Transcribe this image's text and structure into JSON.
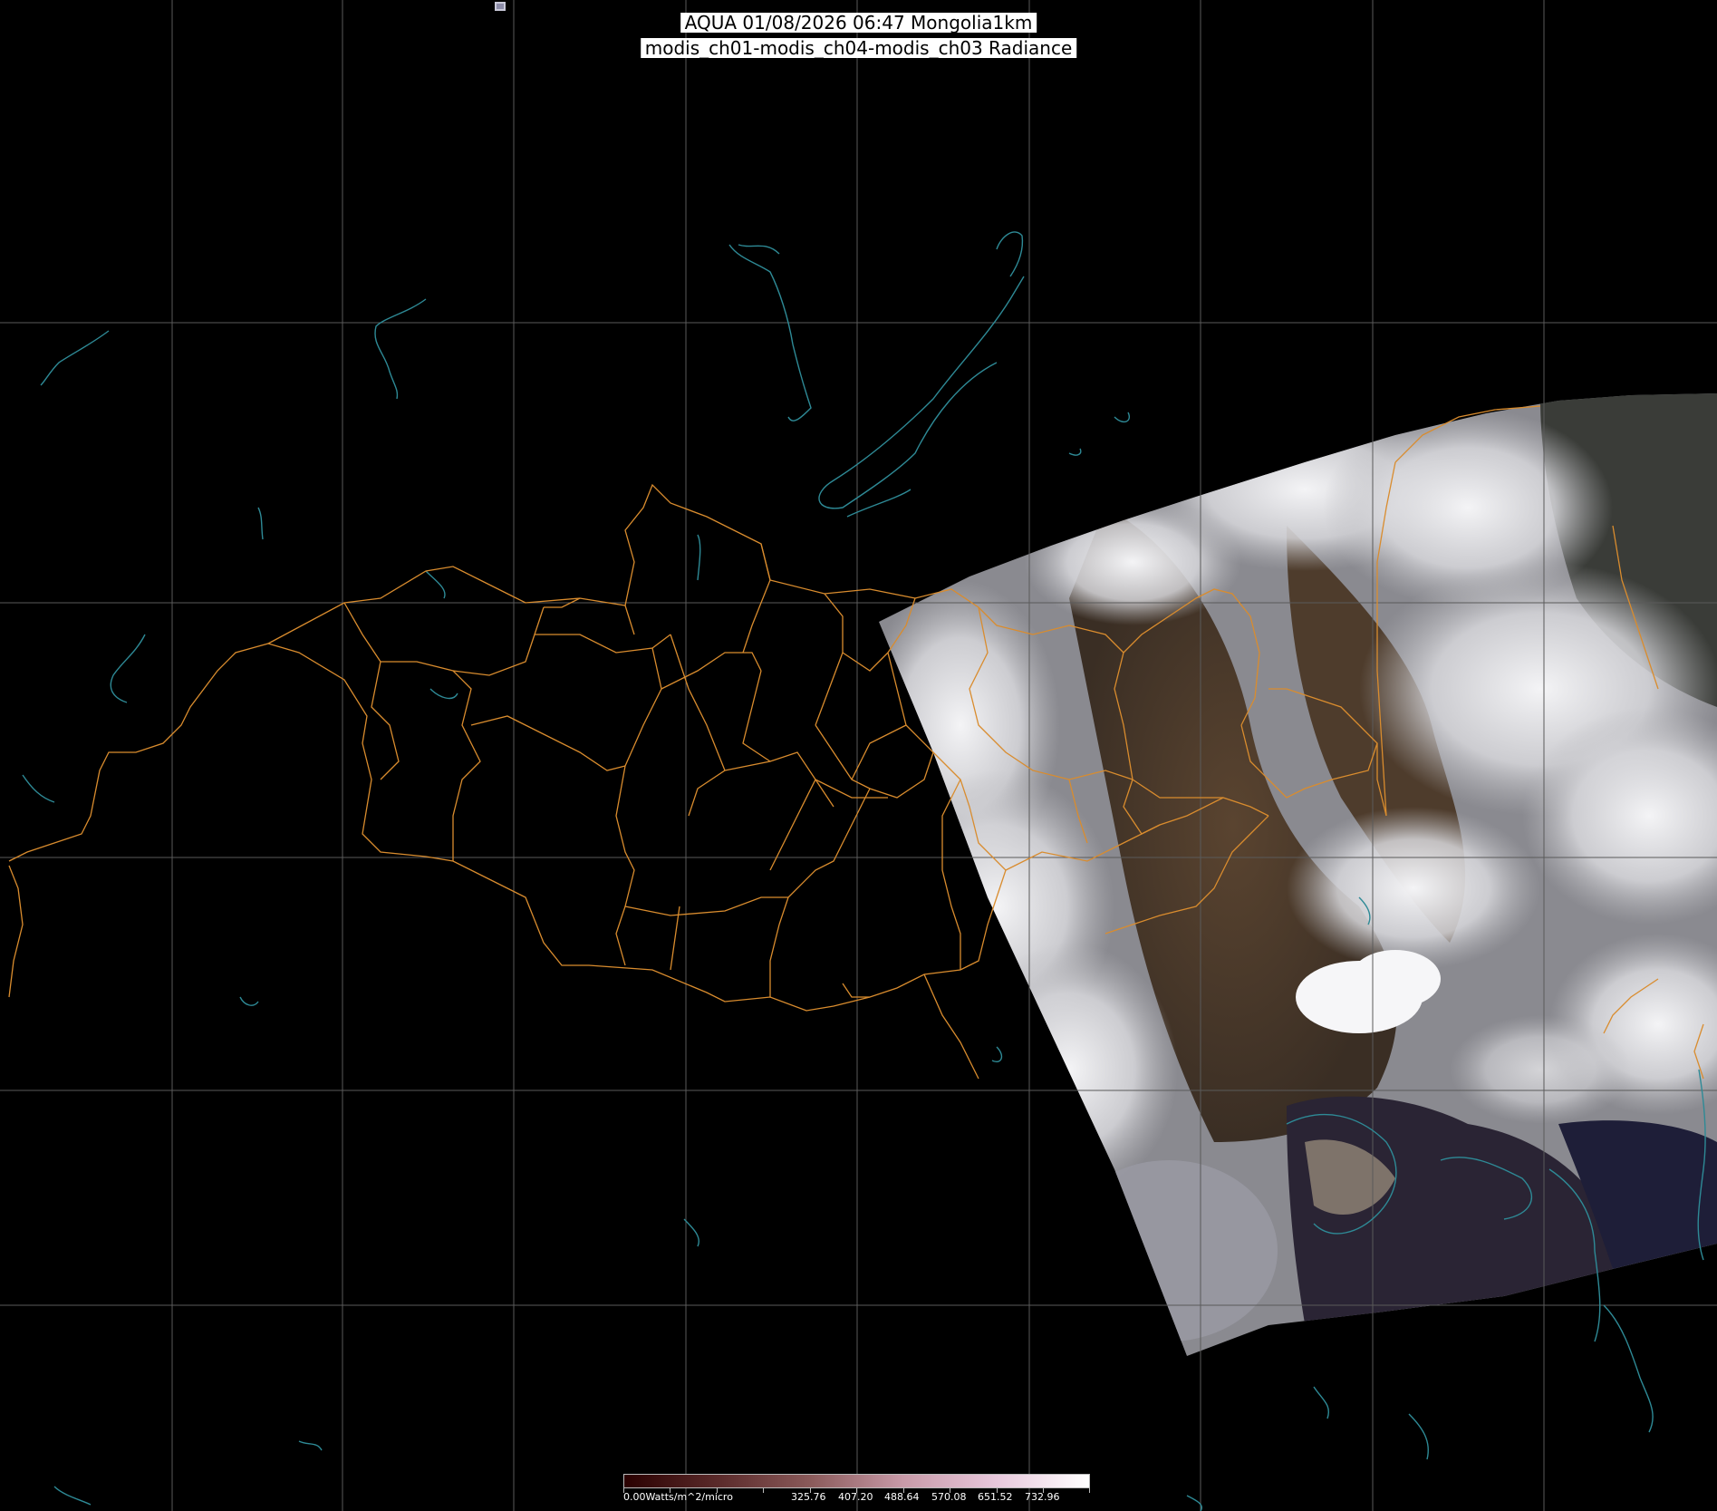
{
  "header": {
    "line1": "AQUA 01/08/2026 06:47 Mongolia1km",
    "line2": "modis_ch01-modis_ch04-modis_ch03 Radiance"
  },
  "colorbar": {
    "unit_label": "0.00Watts/m^2/micro",
    "tick_values": [
      "325.76",
      "407.20",
      "488.64",
      "570.08",
      "651.52",
      "732.96"
    ],
    "colors": [
      "#2a0000",
      "#5a2a2a",
      "#8a5a5a",
      "#c89aa8",
      "#e8c8dc",
      "#ffffff"
    ]
  },
  "map": {
    "colors": {
      "background": "#000000",
      "grid": "#5a5a5a",
      "borders": "#d98c2e",
      "coastline": "#2e8a96",
      "cloud": "#e8e8ec",
      "land": "#4a3a2c",
      "sea": "#2a2434"
    },
    "grid": "on"
  }
}
